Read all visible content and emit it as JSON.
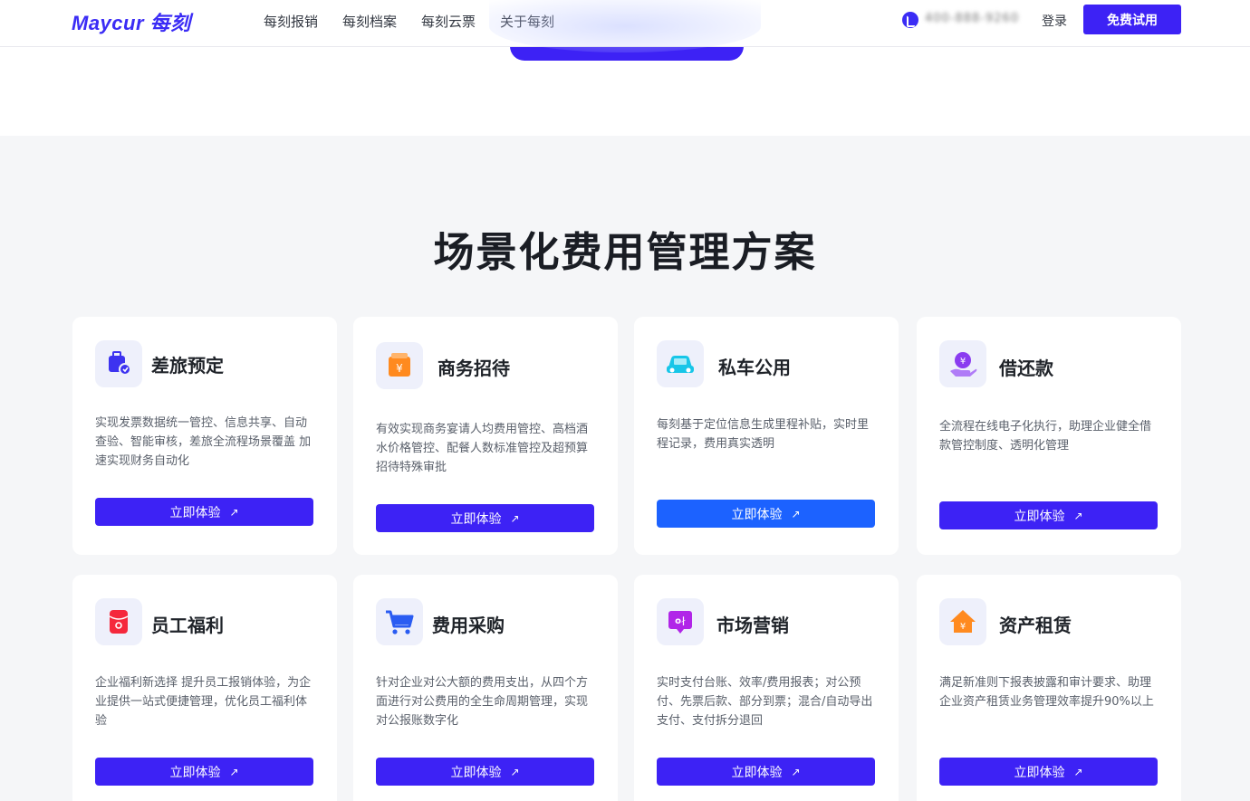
{
  "header": {
    "logo_text": "Maycur 每刻",
    "nav": [
      "每刻报销",
      "每刻档案",
      "每刻云票",
      "关于每刻"
    ],
    "phone_number": "400-888-9260",
    "login_label": "登录",
    "trial_label": "免费试用"
  },
  "section": {
    "title": "场景化费用管理方案"
  },
  "cards": [
    {
      "title": "差旅预定",
      "desc": "实现发票数据统一管控、信息共享、自动查验、智能审核，差旅全流程场景覆盖 加速实现财务自动化",
      "button": "立即体验",
      "icon": "travel-booking-icon"
    },
    {
      "title": "商务招待",
      "desc": "有效实现商务宴请人均费用管控、高档酒水价格管控、配餐人数标准管控及超预算招待特殊审批",
      "button": "立即体验",
      "icon": "business-hospitality-icon"
    },
    {
      "title": "私车公用",
      "desc": "每刻基于定位信息生成里程补贴，实时里程记录，费用真实透明",
      "button": "立即体验",
      "icon": "private-car-icon"
    },
    {
      "title": "借还款",
      "desc": "全流程在线电子化执行，助理企业健全借款管控制度、透明化管理",
      "button": "立即体验",
      "icon": "loan-repayment-icon"
    },
    {
      "title": "员工福利",
      "desc": "企业福利新选择 提升员工报销体验，为企业提供一站式便捷管理，优化员工福利体验",
      "button": "立即体验",
      "icon": "employee-benefits-icon"
    },
    {
      "title": "费用采购",
      "desc": "针对企业对公大额的费用支出，从四个方面进行对公费用的全生命周期管理，实现对公报账数字化",
      "button": "立即体验",
      "icon": "shopping-cart-icon"
    },
    {
      "title": "市场营销",
      "desc": "实时支付台账、效率/费用报表；对公预付、先票后款、部分到票；混合/自动导出支付、支付拆分退回",
      "button": "立即体验",
      "icon": "marketing-icon"
    },
    {
      "title": "资产租赁",
      "desc": "满足新准则下报表披露和审计要求、助理企业资产租赁业务管理效率提升90%以上",
      "button": "立即体验",
      "icon": "asset-leasing-icon"
    }
  ],
  "colors": {
    "brand": "#3d22f5",
    "highlight_button": "#1c62ff",
    "section_bg": "#f5f6f8"
  }
}
